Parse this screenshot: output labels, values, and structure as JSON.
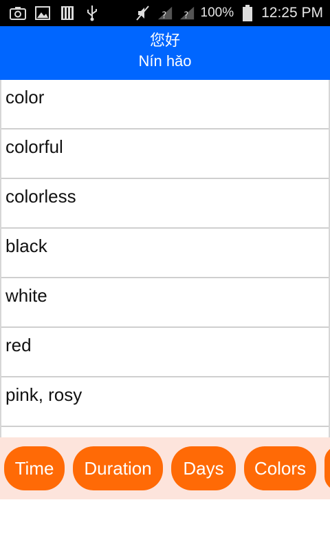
{
  "status_bar": {
    "battery_percent": "100%",
    "time": "12:25 PM",
    "icons": [
      "camera-icon",
      "image-icon",
      "sim-icon",
      "usb-icon",
      "mute-icon",
      "signal-icon",
      "signal-icon",
      "battery-icon"
    ]
  },
  "header": {
    "hanzi": "您好",
    "pinyin": "Nín hǎo",
    "background": "#0066ff"
  },
  "words": [
    "color",
    "colorful",
    "colorless",
    "black",
    "white",
    "red",
    "pink, rosy"
  ],
  "categories": [
    "Time",
    "Duration",
    "Days",
    "Colors"
  ],
  "colors": {
    "category_button": "#ff6a06",
    "category_bar": "#fde4dc"
  }
}
